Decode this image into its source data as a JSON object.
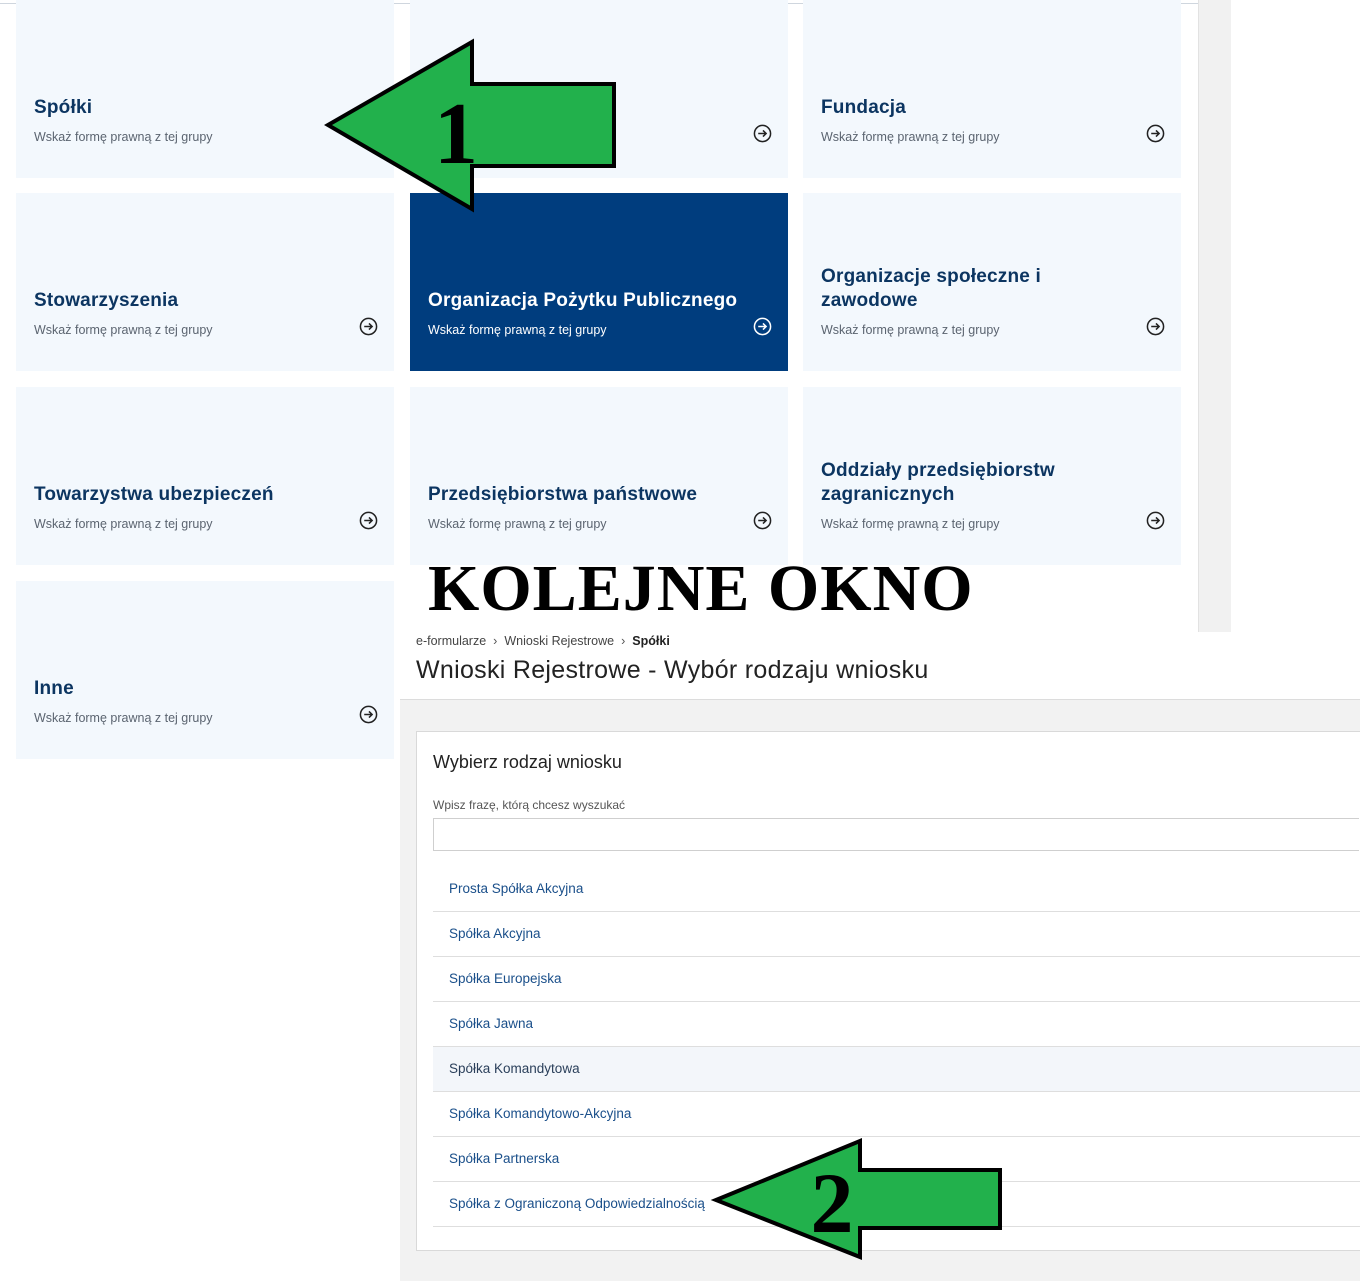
{
  "tiles": [
    {
      "title": "Spółki",
      "subtitle": "Wskaż formę prawną z tej grupy"
    },
    {
      "title": "",
      "subtitle": ""
    },
    {
      "title": "Fundacja",
      "subtitle": "Wskaż formę prawną z tej grupy"
    },
    {
      "title": "Stowarzyszenia",
      "subtitle": "Wskaż formę prawną z tej grupy"
    },
    {
      "title": "Organizacja Pożytku Publicznego",
      "subtitle": "Wskaż formę prawną z tej grupy"
    },
    {
      "title": "Organizacje społeczne i zawodowe",
      "subtitle": "Wskaż formę prawną z tej grupy"
    },
    {
      "title": "Towarzystwa ubezpieczeń",
      "subtitle": "Wskaż formę prawną z tej grupy"
    },
    {
      "title": "Przedsiębiorstwa państwowe",
      "subtitle": "Wskaż formę prawną z tej grupy"
    },
    {
      "title": "Oddziały przedsiębiorstw zagranicznych",
      "subtitle": "Wskaż formę prawną z tej grupy"
    },
    {
      "title": "Inne",
      "subtitle": "Wskaż formę prawną z tej grupy"
    }
  ],
  "annotation": {
    "headline": "KOLEJNE OKNO",
    "arrow1_number": "1",
    "arrow2_number": "2",
    "arrow_color": "#22b14c"
  },
  "breadcrumb": {
    "item1": "e-formularze",
    "item2": "Wnioski Rejestrowe",
    "current": "Spółki"
  },
  "page_title": "Wnioski Rejestrowe - Wybór rodzaju wniosku",
  "panel": {
    "title": "Wybierz rodzaj wniosku",
    "search_label": "Wpisz frazę, którą chcesz wyszukać",
    "search_value": "",
    "search_placeholder": "",
    "items": [
      "Prosta Spółka Akcyjna",
      "Spółka Akcyjna",
      "Spółka Europejska",
      "Spółka Jawna",
      "Spółka Komandytowa",
      "Spółka Komandytowo-Akcyjna",
      "Spółka Partnerska",
      "Spółka z Ograniczoną Odpowiedzialnością"
    ]
  },
  "colors": {
    "tile_bg": "#f3f8fd",
    "tile_active_bg": "#003d7e",
    "tile_title": "#0c3561",
    "link": "#1a4f8a"
  },
  "icons": {
    "tile_arrow": "arrow-right-circle-icon"
  }
}
